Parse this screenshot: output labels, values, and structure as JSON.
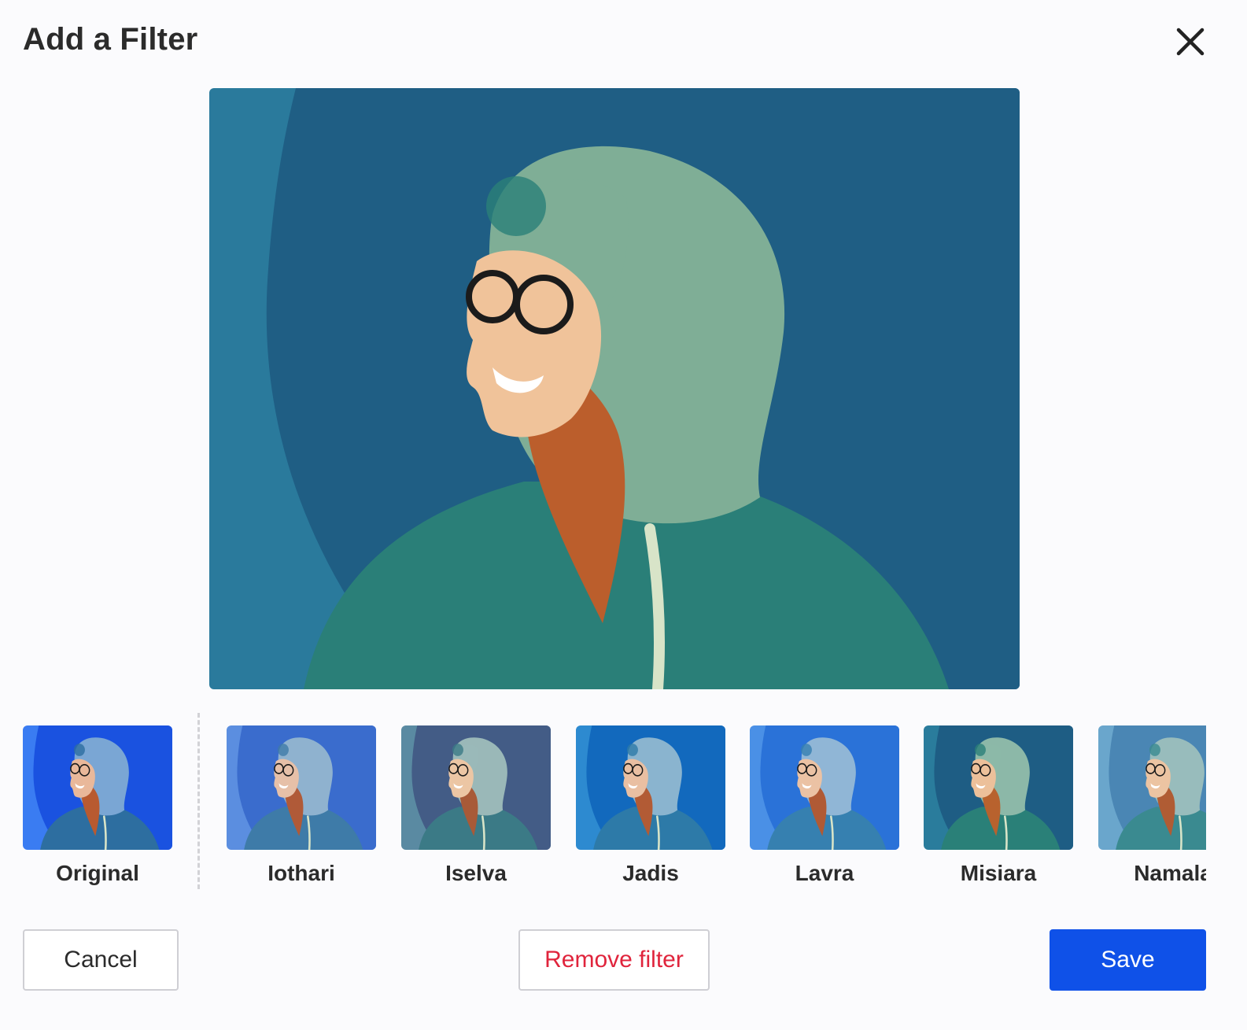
{
  "dialog": {
    "title": "Add a Filter"
  },
  "icons": {
    "close": "close-icon"
  },
  "colors": {
    "save_bg": "#0f51e8",
    "remove_text": "#e0243c"
  },
  "filters": [
    {
      "label": "Original",
      "bg": "#1a52e0",
      "arc": "#3a7cf2",
      "hood": "#7aa6d4",
      "face": "#e9b89a",
      "hair": "#b85a30",
      "jacket": "#2d6ea0"
    },
    {
      "label": "Iothari",
      "bg": "#3a6ccd",
      "arc": "#5b8ee0",
      "hood": "#8fb2cf",
      "face": "#e6c0a8",
      "hair": "#b05a38",
      "jacket": "#3e7ba8"
    },
    {
      "label": "Iselva",
      "bg": "#435c86",
      "arc": "#5a8aa2",
      "hood": "#9ab8b8",
      "face": "#ecc6a4",
      "hair": "#a85a38",
      "jacket": "#3b7a86"
    },
    {
      "label": "Jadis",
      "bg": "#1269bd",
      "arc": "#2d8ad0",
      "hood": "#8ab4cf",
      "face": "#e9bfa2",
      "hair": "#b25b35",
      "jacket": "#2d7aa8"
    },
    {
      "label": "Lavra",
      "bg": "#2a72d8",
      "arc": "#4a90e6",
      "hood": "#90b6d6",
      "face": "#ebc2a4",
      "hair": "#b05a35",
      "jacket": "#3680b0"
    },
    {
      "label": "Misiara",
      "bg": "#1e5d84",
      "arc": "#2a7c9c",
      "hood": "#8cb8a8",
      "face": "#ecc09a",
      "hair": "#b8622e",
      "jacket": "#2a8078"
    },
    {
      "label": "Namala",
      "bg": "#4a86b4",
      "arc": "#6aa6cc",
      "hood": "#98bcbc",
      "face": "#ecc4a2",
      "hair": "#b05c34",
      "jacket": "#3a8a90"
    }
  ],
  "preview": {
    "bg": "#1f5e84",
    "arc": "#2a7a9c",
    "hood": "#7fae96",
    "face": "#f0c39a",
    "hair": "#bb5e2c",
    "jacket": "#2a7f78"
  },
  "buttons": {
    "cancel": "Cancel",
    "remove": "Remove filter",
    "save": "Save"
  }
}
